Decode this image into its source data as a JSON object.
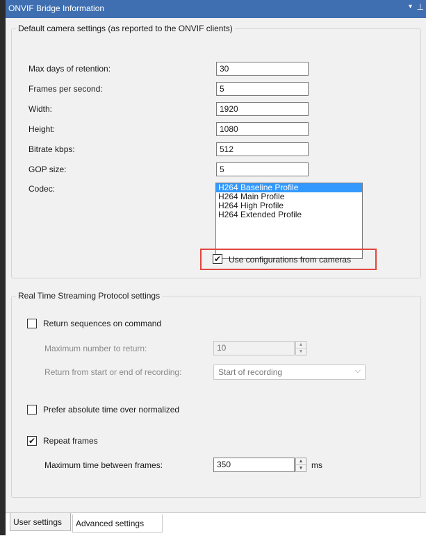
{
  "title_bar": {
    "title": "ONVIF Bridge Information",
    "dropdown_glyph": "▾",
    "pin_glyph": "⊥"
  },
  "default_settings": {
    "legend": "Default camera settings (as reported to the ONVIF clients)",
    "max_days_label": "Max days of retention:",
    "max_days_value": "30",
    "fps_label": "Frames per second:",
    "fps_value": "5",
    "width_label": "Width:",
    "width_value": "1920",
    "height_label": "Height:",
    "height_value": "1080",
    "bitrate_label": "Bitrate kbps:",
    "bitrate_value": "512",
    "gop_label": "GOP size:",
    "gop_value": "5",
    "codec_label": "Codec:",
    "codec_options": [
      "H264 Baseline Profile",
      "H264 Main Profile",
      "H264 High Profile",
      "H264 Extended Profile"
    ],
    "codec_selected": "H264 Baseline Profile",
    "use_config_label": "Use configurations from cameras",
    "use_config_checked": true
  },
  "rtsp": {
    "legend": "Real Time Streaming Protocol settings",
    "return_sequences_label": "Return sequences on command",
    "return_sequences_checked": false,
    "max_number_label": "Maximum number to return:",
    "max_number_value": "10",
    "return_from_label": "Return from start or end of recording:",
    "return_from_value": "Start of recording",
    "prefer_absolute_label": "Prefer absolute time over normalized",
    "prefer_absolute_checked": false,
    "repeat_frames_label": "Repeat frames",
    "repeat_frames_checked": true,
    "max_time_label": "Maximum time between frames:",
    "max_time_value": "350",
    "max_time_unit": "ms"
  },
  "tabs": [
    {
      "label": "User settings",
      "active": true
    },
    {
      "label": "Advanced settings",
      "active": false
    }
  ],
  "glyphs": {
    "check": "✔",
    "spin_up": "▲",
    "spin_down": "▼",
    "select_arrow": "⌵"
  },
  "colors": {
    "title_bar": "#3f6fb0",
    "selection": "#3399ff",
    "highlight": "#e0463e"
  }
}
